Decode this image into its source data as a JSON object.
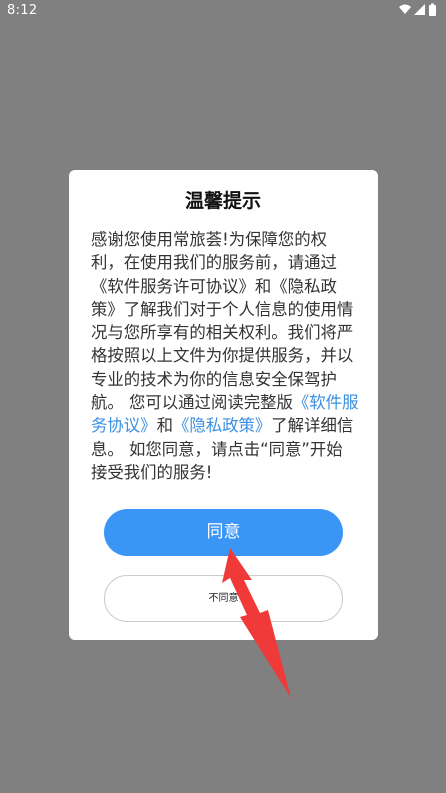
{
  "status_bar": {
    "time": "8:12",
    "icons": [
      "wifi-icon",
      "cell-signal-icon",
      "battery-icon"
    ]
  },
  "dialog": {
    "title": "温馨提示",
    "body": {
      "intro": "感谢您使用常旅荟!为保障您的权利，在使用我们的服务前，请通过",
      "link_software_license": "《软件服务许可协议》",
      "and_1": "和",
      "link_privacy_1": "《隐私政策》",
      "middle": "了解我们对于个人信息的使用情况与您所享有的相关权利。我们将严格按照以上文件为你提供服务，并以专业的技术为你的信息安全保驾护航。 您可以通过阅读完整版",
      "link_software_service": "《软件服务协议》",
      "and_2": "和",
      "link_privacy_2": "《隐私政策》",
      "outro": "了解详细信息。 如您同意，请点击“同意”开始接受我们的服务!"
    },
    "agree_label": "同意",
    "disagree_label": "不同意"
  },
  "colors": {
    "overlay": "#808080",
    "primary_button": "#3a95f5",
    "link": "#3b8fe0",
    "annotation_arrow": "#f03a3a"
  },
  "annotation": {
    "type": "arrow",
    "points_to": "agree-button"
  }
}
